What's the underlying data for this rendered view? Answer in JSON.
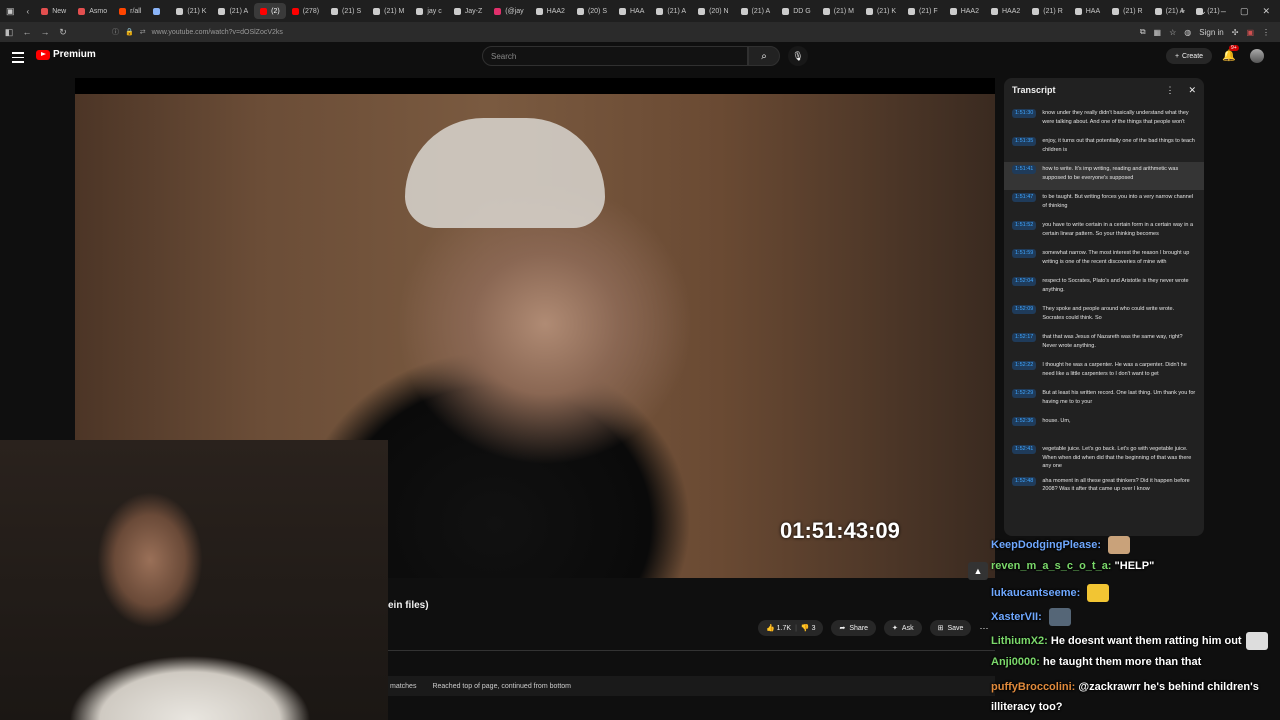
{
  "browser": {
    "tabs": [
      {
        "label": "New",
        "color": "#e34f4f"
      },
      {
        "label": "Asmo",
        "color": "#e34f4f"
      },
      {
        "label": "r/all",
        "color": "#ff4500"
      },
      {
        "label": "",
        "color": "#8ab4f8"
      },
      {
        "label": "(21) K",
        "color": "#cccccc"
      },
      {
        "label": "(21) A",
        "color": "#cccccc"
      },
      {
        "label": "(2)",
        "color": "#ff0000",
        "active": true
      },
      {
        "label": "(278)",
        "color": "#ff0000"
      },
      {
        "label": "(21) S",
        "color": "#cccccc"
      },
      {
        "label": "(21) M",
        "color": "#cccccc"
      },
      {
        "label": "jay c",
        "color": "#cccccc"
      },
      {
        "label": "Jay-Z",
        "color": "#cccccc"
      },
      {
        "label": "(@jay",
        "color": "#e1306c"
      },
      {
        "label": "HAA2",
        "color": "#cccccc"
      },
      {
        "label": "(20) S",
        "color": "#cccccc"
      },
      {
        "label": "HAA",
        "color": "#cccccc"
      },
      {
        "label": "(21) A",
        "color": "#cccccc"
      },
      {
        "label": "(20) N",
        "color": "#cccccc"
      },
      {
        "label": "(21) A",
        "color": "#cccccc"
      },
      {
        "label": "DD G",
        "color": "#cccccc"
      },
      {
        "label": "(21) M",
        "color": "#cccccc"
      },
      {
        "label": "(21) K",
        "color": "#cccccc"
      },
      {
        "label": "(21) F",
        "color": "#cccccc"
      },
      {
        "label": "HAA2",
        "color": "#cccccc"
      },
      {
        "label": "HAA2",
        "color": "#cccccc"
      },
      {
        "label": "(21) R",
        "color": "#cccccc"
      },
      {
        "label": "HAA",
        "color": "#cccccc"
      },
      {
        "label": "(21) R",
        "color": "#cccccc"
      },
      {
        "label": "(21) A",
        "color": "#cccccc"
      },
      {
        "label": "(21)",
        "color": "#cccccc"
      }
    ],
    "url": "youtube.com/watch?v=dOSlZocV2ks",
    "url_prefix": "www.",
    "sign_in": "Sign in"
  },
  "youtube": {
    "logo_text": "Premium",
    "search_placeholder": "Search",
    "create_label": "Create",
    "bell_badge": "9+",
    "video_title_fragment": "ein files)",
    "like_count": "1.7K",
    "dislike_count": "3",
    "share_label": "Share",
    "ask_label": "Ask",
    "save_label": "Save",
    "find_matches": "matches",
    "find_status": "Reached top of page, continued from bottom"
  },
  "video": {
    "timecode": "01:51:43:09"
  },
  "transcript": {
    "title": "Transcript",
    "segments": [
      {
        "time": "1:51:30",
        "text": "know under they really didn't basically understand what they were talking about. And one of the things that people won't"
      },
      {
        "time": "1:51:35",
        "text": "enjoy, it turns out that potentially one of the bad things to teach children is"
      },
      {
        "time": "1:51:41",
        "text": "how to write. It's imp writing, reading and arithmetic was supposed to be everyone's supposed",
        "active": true
      },
      {
        "time": "1:51:47",
        "text": "to be taught. But writing forces you into a very narrow channel of thinking"
      },
      {
        "time": "1:51:52",
        "text": "you have to write certain in a certain form in a certain way in a certain linear pattern. So your thinking becomes"
      },
      {
        "time": "1:51:59",
        "text": "somewhat narrow. The most interest the reason I brought up writing is one of the recent discoveries of mine with"
      },
      {
        "time": "1:52:04",
        "text": "respect to Socrates, Plato's and Aristotle is they never wrote anything."
      },
      {
        "time": "1:52:09",
        "text": "They spoke and people around who could write wrote. Socrates could think. So"
      },
      {
        "time": "1:52:17",
        "text": "that that was Jesus of Nazareth was the same way, right? Never wrote anything."
      },
      {
        "time": "1:52:22",
        "text": "I thought he was a carpenter. He was a carpenter. Didn't he need like a little carpenters to I don't want to get"
      },
      {
        "time": "1:52:29",
        "text": "But at least his written record. One last thing. Um thank you for having me to to your"
      },
      {
        "time": "1:52:36",
        "text": "house. Um,"
      },
      {
        "time": "1:52:41",
        "text": "vegetable juice. Let's go back. Let's go with vegetable juice. When when did when did that the beginning of that was there any one"
      },
      {
        "time": "1:52:48",
        "text": "aha moment in all these great thinkers? Did it happen before 2008? Was it after that came up over I know"
      }
    ]
  },
  "chat": [
    {
      "user": "KeepDodgingPlease:",
      "message": "",
      "user_color": "#6fa8ff",
      "emote": "dog-emote"
    },
    {
      "user": "reven_m_a_s_c_o_t_a:",
      "message": "\"HELP\"",
      "user_color": "#7bd96b",
      "emote": ""
    },
    {
      "user": "lukaucantseeme:",
      "message": "",
      "user_color": "#6fa8ff",
      "emote": "yellow-face-emote"
    },
    {
      "user": "XasterVII:",
      "message": "",
      "user_color": "#6fa8ff",
      "emote": "image-emote"
    },
    {
      "user": "LithiumX2:",
      "message": "He doesnt want them ratting him out",
      "user_color": "#7bd96b",
      "emote": "trollface-emote"
    },
    {
      "user": "Anji0000:",
      "message": "he taught them more than that",
      "user_color": "#7bd96b",
      "emote": ""
    },
    {
      "user": "puffyBroccolini:",
      "message": "@zackrawrr he's behind children's",
      "user_color": "#e08a3c",
      "emote": ""
    },
    {
      "user": "",
      "message": "illiteracy too?",
      "user_color": "#ffffff",
      "emote": ""
    }
  ]
}
